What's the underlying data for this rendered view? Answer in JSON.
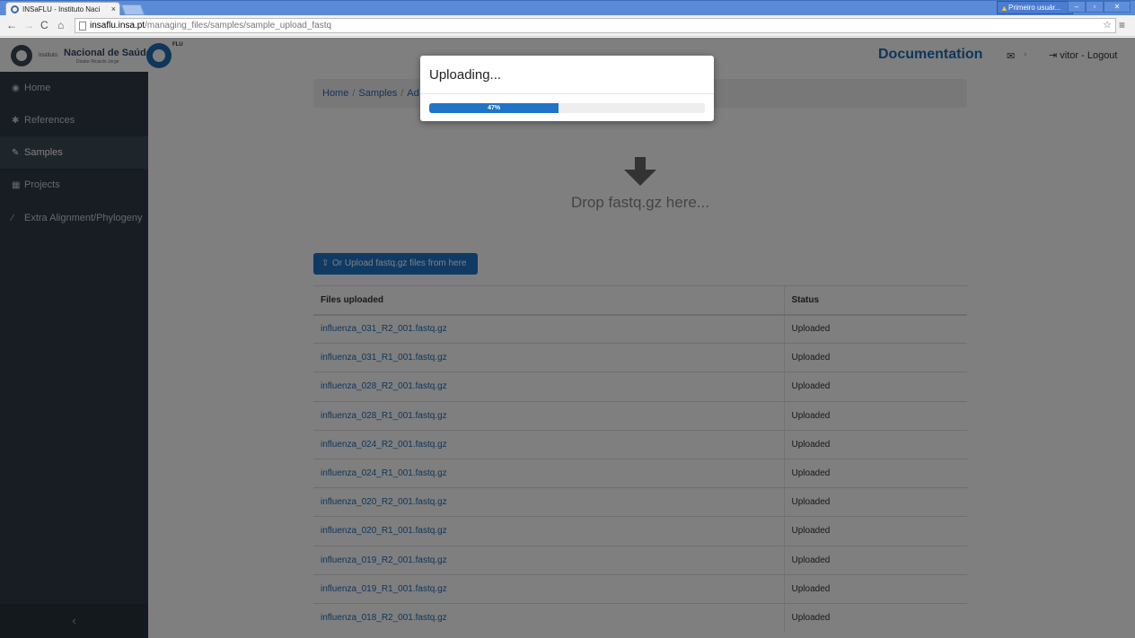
{
  "browser": {
    "tab_title": "INSaFLU - Instituto Naci",
    "tab_close": "×",
    "user_badge": "Primeiro usuár...",
    "win_min": "–",
    "win_restore": "▫",
    "win_close": "✕",
    "url_host": "insaflu.insa.pt",
    "url_path": "/managing_files/samples/sample_upload_fastq"
  },
  "header": {
    "logo_inst": "Instituto",
    "logo_name": "Nacional de Saúde",
    "logo_sub": "Doutor Ricardo Jorge",
    "logo_flu": "FLU",
    "documentation": "Documentation",
    "user_logout": "vitor - Logout"
  },
  "sidebar": {
    "items": [
      {
        "label": "Home",
        "icon": "dashboard-icon"
      },
      {
        "label": "References",
        "icon": "bug-icon"
      },
      {
        "label": "Samples",
        "icon": "wrench-icon"
      },
      {
        "label": "Projects",
        "icon": "table-icon"
      },
      {
        "label": "Extra Alignment/Phylogeny",
        "icon": "magic-icon"
      }
    ],
    "collapse": "‹"
  },
  "breadcrumb": [
    "Home",
    "Samples",
    "Ad"
  ],
  "drop_text": "Drop fastq.gz here...",
  "upload_button": "Or Upload fastq.gz files from here",
  "table": {
    "headers": [
      "Files uploaded",
      "Status"
    ],
    "rows": [
      [
        "influenza_031_R2_001.fastq.gz",
        "Uploaded"
      ],
      [
        "influenza_031_R1_001.fastq.gz",
        "Uploaded"
      ],
      [
        "influenza_028_R2_001.fastq.gz",
        "Uploaded"
      ],
      [
        "influenza_028_R1_001.fastq.gz",
        "Uploaded"
      ],
      [
        "influenza_024_R2_001.fastq.gz",
        "Uploaded"
      ],
      [
        "influenza_024_R1_001.fastq.gz",
        "Uploaded"
      ],
      [
        "influenza_020_R2_001.fastq.gz",
        "Uploaded"
      ],
      [
        "influenza_020_R1_001.fastq.gz",
        "Uploaded"
      ],
      [
        "influenza_019_R2_001.fastq.gz",
        "Uploaded"
      ],
      [
        "influenza_019_R1_001.fastq.gz",
        "Uploaded"
      ],
      [
        "influenza_018_R2_001.fastq.gz",
        "Uploaded"
      ]
    ]
  },
  "modal": {
    "title": "Uploading...",
    "progress_label": "47%",
    "progress_percent": 47
  },
  "colors": {
    "accent": "#1f74c8",
    "sidebar_bg": "#2f3b45",
    "link": "#1e6cb5"
  }
}
